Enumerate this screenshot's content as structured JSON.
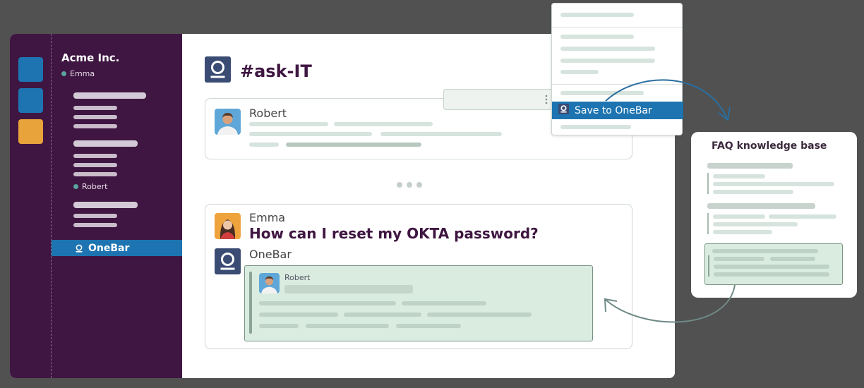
{
  "sidebar": {
    "org_name": "Acme Inc.",
    "current_user": "Emma",
    "dm_robert": "Robert",
    "active_item": "OneBar",
    "workspace_colors": [
      "#1d74b1",
      "#1d74b1",
      "#e8a33b"
    ]
  },
  "channel": {
    "name": "#ask-IT"
  },
  "messages": {
    "robert": {
      "author": "Robert"
    },
    "emma": {
      "author": "Emma",
      "text": "How can I reset my OKTA password?"
    },
    "onebar": {
      "author": "OneBar",
      "quoted_author": "Robert"
    }
  },
  "context_menu": {
    "save_label": "Save to OneBar"
  },
  "faq": {
    "title": "FAQ knowledge base"
  },
  "icons": {
    "onebar_logo": "onebar-logo-icon",
    "status_dot": "presence-dot-icon",
    "more_actions": "vertical-ellipsis-icon"
  },
  "colors": {
    "sidebar_bg": "#3f1641",
    "accent_blue": "#1d74b1",
    "onebar_logo_bg": "#3a4b74",
    "highlight_green": "#d9ecdf"
  }
}
